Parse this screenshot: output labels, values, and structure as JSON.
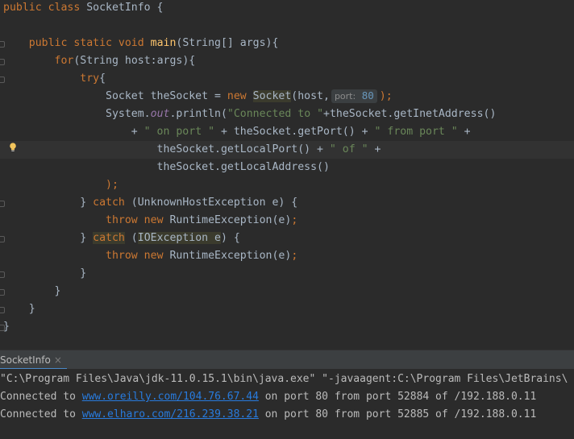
{
  "editor": {
    "lines": [
      [
        {
          "t": "public class ",
          "c": "kw"
        },
        {
          "t": "SocketInfo {",
          "c": ""
        }
      ],
      [],
      [
        {
          "t": "    "
        },
        {
          "t": "public static void ",
          "c": "kw"
        },
        {
          "t": "main",
          "c": "fn"
        },
        {
          "t": "(String[] args){",
          "c": ""
        }
      ],
      [
        {
          "t": "        "
        },
        {
          "t": "for",
          "c": "kw"
        },
        {
          "t": "(String host:args){",
          "c": ""
        }
      ],
      [
        {
          "t": "            "
        },
        {
          "t": "try",
          "c": "kw"
        },
        {
          "t": "{",
          "c": ""
        }
      ],
      [
        {
          "t": "                Socket theSocket = "
        },
        {
          "t": "new ",
          "c": "kw"
        },
        {
          "t": "Socket",
          "c": "hlx"
        },
        {
          "t": "(host,",
          "c": ""
        },
        {
          "hint": "port:",
          "hv": "80"
        },
        {
          "t": ");",
          "c": "kw"
        }
      ],
      [
        {
          "t": "                System."
        },
        {
          "t": "out",
          "c": "fld"
        },
        {
          "t": ".println("
        },
        {
          "t": "\"Connected to \"",
          "c": "str"
        },
        {
          "t": "+theSocket.getInetAddress()"
        }
      ],
      [
        {
          "t": "                    + "
        },
        {
          "t": "\" on port \"",
          "c": "str"
        },
        {
          "t": " + theSocket.getPort() + "
        },
        {
          "t": "\" from port \"",
          "c": "str"
        },
        {
          "t": " +"
        }
      ],
      [
        {
          "t": "                        theSocket.getLocalPort() + "
        },
        {
          "t": "\" of \"",
          "c": "str"
        },
        {
          "t": " +"
        }
      ],
      [
        {
          "t": "                        theSocket.getLocalAddress()"
        }
      ],
      [
        {
          "t": "                "
        },
        {
          "t": ");",
          "c": "kw"
        }
      ],
      [
        {
          "t": "            } "
        },
        {
          "t": "catch ",
          "c": "kw"
        },
        {
          "t": "(UnknownHostException e) {"
        }
      ],
      [
        {
          "t": "                "
        },
        {
          "t": "throw new ",
          "c": "kw"
        },
        {
          "t": "RuntimeException(e)"
        },
        {
          "t": ";",
          "c": "kw"
        }
      ],
      [
        {
          "t": "            } "
        },
        {
          "t": "catch",
          "c": "kw hlx"
        },
        {
          "t": " ("
        },
        {
          "t": "IOException e",
          "c": "hlx"
        },
        {
          "t": ") {"
        }
      ],
      [
        {
          "t": "                "
        },
        {
          "t": "throw new ",
          "c": "kw"
        },
        {
          "t": "RuntimeException(e)"
        },
        {
          "t": ";",
          "c": "kw"
        }
      ],
      [
        {
          "t": "            }"
        }
      ],
      [
        {
          "t": "        }"
        }
      ],
      [
        {
          "t": "    }"
        }
      ],
      [
        {
          "t": "}"
        }
      ]
    ]
  },
  "run_panel": {
    "tab_label": "SocketInfo",
    "close_glyph": "×",
    "console": {
      "command": "\"C:\\Program Files\\Java\\jdk-11.0.15.1\\bin\\java.exe\" \"-javaagent:C:\\Program Files\\JetBrains\\",
      "outputs": [
        {
          "prefix": "Connected to ",
          "link": "www.oreilly.com/104.76.67.44",
          "suffix": " on port 80 from port 52884 of /192.188.0.11"
        },
        {
          "prefix": "Connected to ",
          "link": "www.elharo.com/216.239.38.21",
          "suffix": " on port 80 from port 52885 of /192.188.0.11"
        }
      ]
    }
  },
  "colors": {
    "background": "#2b2b2b",
    "keyword": "#cc7832",
    "method": "#ffc66d",
    "string": "#6a8759",
    "number": "#6897bb",
    "field": "#9876aa",
    "link": "#287bde"
  },
  "icons": {
    "intention_bulb": "lightbulb-icon",
    "fold_markers": "fold-marker-icon"
  }
}
